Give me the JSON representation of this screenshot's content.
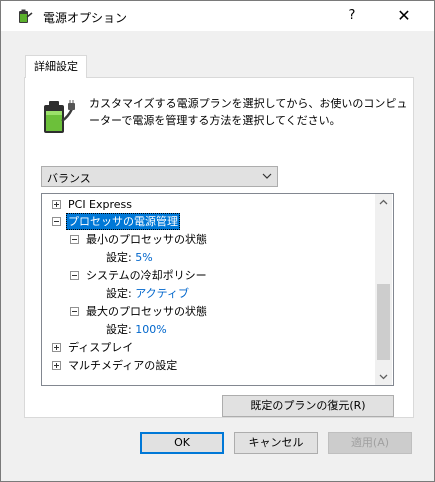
{
  "window": {
    "title": "電源オプション",
    "help_label": "?",
    "close_label": "✕"
  },
  "tab": {
    "label": "詳細設定"
  },
  "description": "カスタマイズする電源プランを選択してから、お使いのコンピューターで電源を管理する方法を選択してください。",
  "plan_select": {
    "value": "バランス"
  },
  "tree": {
    "pci_express": "PCI Express",
    "processor_power": "プロセッサの電源管理",
    "min_state": "最小のプロセッサの状態",
    "min_state_setting_label": "設定:",
    "min_state_setting_value": "5%",
    "cooling_policy": "システムの冷却ポリシー",
    "cooling_setting_label": "設定:",
    "cooling_setting_value": "アクティブ",
    "max_state": "最大のプロセッサの状態",
    "max_state_setting_label": "設定:",
    "max_state_setting_value": "100%",
    "display": "ディスプレイ",
    "multimedia": "マルチメディアの設定"
  },
  "buttons": {
    "restore": "既定のプランの復元(R)",
    "ok": "OK",
    "cancel": "キャンセル",
    "apply": "適用(A)"
  },
  "colors": {
    "selection": "#0078d7",
    "setting_value": "#0066cc"
  }
}
